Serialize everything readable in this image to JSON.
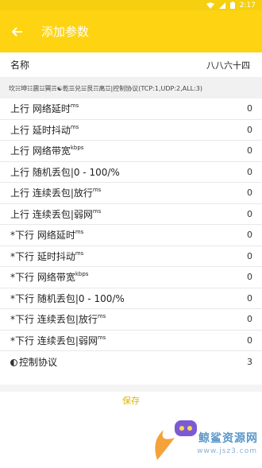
{
  "status": {
    "time": "2:17"
  },
  "appbar": {
    "title": "添加参数",
    "back_icon": "arrow-left-icon"
  },
  "name": {
    "label": "名称",
    "value": "八八六十四"
  },
  "protocol_hint": "坎☵坤☷震☳巽☴☯乾☰兑☱艮☶离☲|控制协议(TCP:1,UDP:2,ALL:3)",
  "params": [
    {
      "label": "上行 网络延时",
      "unit": "ms",
      "value": "0"
    },
    {
      "label": "上行 延时抖动",
      "unit": "ms",
      "value": "0"
    },
    {
      "label": "上行 网络带宽",
      "unit": "kbps",
      "value": "0"
    },
    {
      "label": "上行 随机丢包|0 - 100/%",
      "unit": "",
      "value": "0"
    },
    {
      "label": "上行 连续丢包|放行",
      "unit": "ms",
      "value": "0"
    },
    {
      "label": "上行 连续丢包|弱网",
      "unit": "ms",
      "value": "0"
    },
    {
      "label": "*下行 网络延时",
      "unit": "ms",
      "value": "0"
    },
    {
      "label": "*下行 延时抖动",
      "unit": "ms",
      "value": "0"
    },
    {
      "label": "*下行 网络带宽",
      "unit": "kbps",
      "value": "0"
    },
    {
      "label": "*下行 随机丢包|0 - 100/%",
      "unit": "",
      "value": "0"
    },
    {
      "label": "*下行 连续丢包|放行",
      "unit": "ms",
      "value": "0"
    },
    {
      "label": "*下行 连续丢包|弱网",
      "unit": "ms",
      "value": "0"
    }
  ],
  "control_protocol": {
    "label": "控制协议",
    "value": "3"
  },
  "save_label": "保存",
  "watermark": {
    "text": "鲸鲨资源网",
    "url": "www.jsz3.com"
  },
  "colors": {
    "accent": "#fed312",
    "save_text": "#e0b400"
  }
}
